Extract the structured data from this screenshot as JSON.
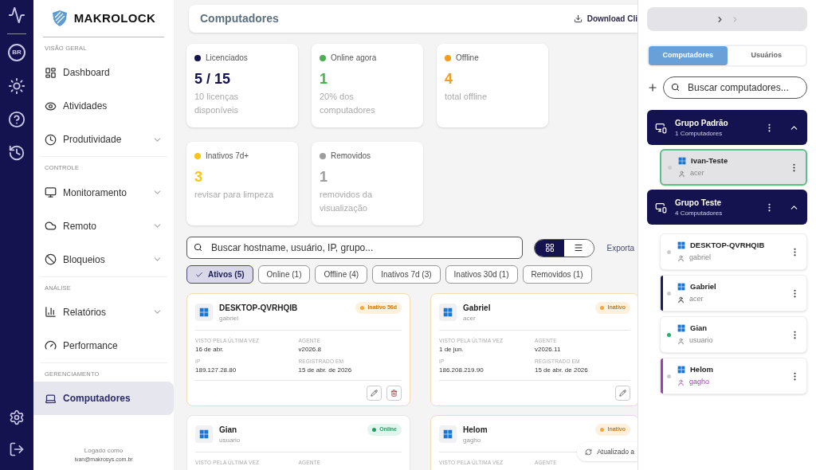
{
  "rail": {
    "avatar": "BR"
  },
  "sidebar": {
    "logo": "MAKROLOCK",
    "sections": [
      {
        "title": "VISÃO GERAL",
        "items": [
          {
            "label": "Dashboard",
            "expandable": false,
            "selected": false
          },
          {
            "label": "Atividades",
            "expandable": false,
            "selected": false
          },
          {
            "label": "Produtividade",
            "expandable": true,
            "selected": false
          }
        ]
      },
      {
        "title": "CONTROLE",
        "items": [
          {
            "label": "Monitoramento",
            "expandable": true,
            "selected": false
          },
          {
            "label": "Remoto",
            "expandable": true,
            "selected": false
          },
          {
            "label": "Bloqueios",
            "expandable": true,
            "selected": false
          }
        ]
      },
      {
        "title": "ANÁLISE",
        "items": [
          {
            "label": "Relatórios",
            "expandable": true,
            "selected": false
          },
          {
            "label": "Performance",
            "expandable": false,
            "selected": false
          }
        ]
      },
      {
        "title": "GERENCIAMENTO",
        "items": [
          {
            "label": "Computadores",
            "expandable": false,
            "selected": true
          }
        ]
      }
    ],
    "footer": {
      "label": "Logado como",
      "email": "ivan@makrosys.com.br"
    }
  },
  "header": {
    "title": "Computadores",
    "download": "Download Cli"
  },
  "stats": [
    {
      "label": "Licenciados",
      "value": "5 / 15",
      "note": "10 licenças disponíveis",
      "color": "#14124f"
    },
    {
      "label": "Online agora",
      "value": "1",
      "note": "20% dos computadores",
      "color": "#4caf50"
    },
    {
      "label": "Offline",
      "value": "4",
      "note": "total offline",
      "color": "#f39c1f"
    },
    {
      "label": "Inativos 7d+",
      "value": "3",
      "note": "revisar para limpeza",
      "color": "#f5c518"
    },
    {
      "label": "Removidos",
      "value": "1",
      "note": "removidos da visualização",
      "color": "#9e9e9e"
    }
  ],
  "search": {
    "placeholder": "Buscar hostname, usuário, IP, grupo..."
  },
  "views": [
    {
      "kind": "grid",
      "selected": true
    },
    {
      "kind": "list",
      "selected": false
    }
  ],
  "export": "Exporta",
  "filters": [
    {
      "label": "Ativos (5)",
      "selected": true
    },
    {
      "label": "Online (1)",
      "selected": false
    },
    {
      "label": "Offline (4)",
      "selected": false
    },
    {
      "label": "Inativos 7d (3)",
      "selected": false
    },
    {
      "label": "Inativos 30d (1)",
      "selected": false
    },
    {
      "label": "Removidos (1)",
      "selected": false
    }
  ],
  "computers": [
    {
      "name": "DESKTOP-QVRHQIB",
      "user": "gabriel",
      "status": {
        "kind": "inactive",
        "label": "Inativo 56d"
      },
      "fields": [
        {
          "label": "VISTO PELA ÚLTIMA VEZ",
          "value": "16 de abr."
        },
        {
          "label": "AGENTE",
          "value": "v2026.8"
        },
        {
          "label": "IP",
          "value": "189.127.28.80"
        },
        {
          "label": "REGISTRADO EM",
          "value": "15 de abr. de 2026"
        }
      ],
      "actions": [
        {
          "kind": "edit"
        },
        {
          "kind": "delete"
        }
      ]
    },
    {
      "name": "Gabriel",
      "user": "acer",
      "status": {
        "kind": "inactive",
        "label": "Inativo"
      },
      "fields": [
        {
          "label": "VISTO PELA ÚLTIMA VEZ",
          "value": "1 de jun."
        },
        {
          "label": "AGENTE",
          "value": "v2026.11"
        },
        {
          "label": "IP",
          "value": "186.208.219.90"
        },
        {
          "label": "REGISTRADO EM",
          "value": "15 de abr. de 2026"
        }
      ],
      "actions": [
        {
          "kind": "edit"
        }
      ]
    },
    {
      "name": "Gian",
      "user": "usuario",
      "status": {
        "kind": "online",
        "label": "Online"
      },
      "fields": [
        {
          "label": "VISTO PELA ÚLTIMA VEZ"
        },
        {
          "label": "AGENTE"
        }
      ]
    },
    {
      "name": "Helom",
      "user": "gagho",
      "status": {
        "kind": "inactive",
        "label": "Inativo"
      },
      "fields": [
        {
          "label": "VISTO PELA ÚLTIMA VEZ"
        },
        {
          "label": "AGENTE"
        }
      ]
    }
  ],
  "toast": "Atualizado a",
  "panel": {
    "tabs": [
      {
        "label": "Computadores",
        "selected": true
      },
      {
        "label": "Usuários",
        "selected": false
      }
    ],
    "search": {
      "placeholder": "Buscar computadores..."
    },
    "groups": [
      {
        "name": "Grupo Padrão",
        "count": "1 Computadores",
        "expanded": true,
        "items": [
          {
            "name": "Ivan-Teste",
            "user": "acer",
            "online": false,
            "selected": true
          }
        ]
      },
      {
        "name": "Grupo Teste",
        "count": "4 Computadores",
        "expanded": true,
        "items": [
          {
            "name": "DESKTOP-QVRHQIB",
            "user": "gabriel",
            "online": false,
            "selected": false
          },
          {
            "name": "Gabriel",
            "user": "acer",
            "online": false,
            "selected": false,
            "color": "#1a1a5e"
          },
          {
            "name": "Gian",
            "user": "usuario",
            "online": true,
            "selected": false
          },
          {
            "name": "Helom",
            "user": "gagho",
            "online": false,
            "selected": false,
            "color": "#9c3fb0"
          }
        ]
      }
    ]
  }
}
